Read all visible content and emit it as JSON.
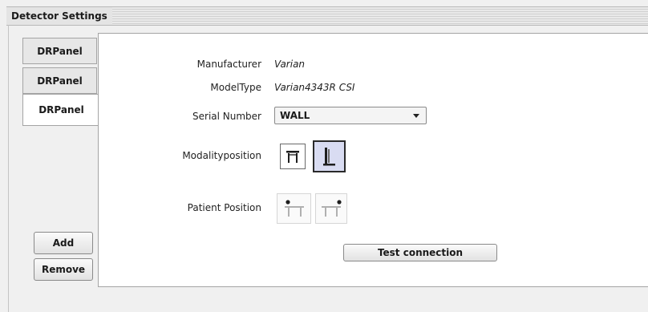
{
  "panel": {
    "title": "Detector Settings"
  },
  "tabs": [
    {
      "label": "DRPanel",
      "active": false
    },
    {
      "label": "DRPanel",
      "active": false
    },
    {
      "label": "DRPanel",
      "active": true
    }
  ],
  "sidebar_buttons": {
    "add": "Add",
    "remove": "Remove"
  },
  "form": {
    "manufacturer": {
      "label": "Manufacturer",
      "value": "Varian"
    },
    "model_type": {
      "label": "ModelType",
      "value": "Varian4343R CSI"
    },
    "serial_number": {
      "label": "Serial Number",
      "selected": "WALL"
    },
    "modality_position": {
      "label": "Modalityposition",
      "options": [
        {
          "icon": "table-detector-icon",
          "selected": false
        },
        {
          "icon": "wall-detector-icon",
          "selected": true
        }
      ]
    },
    "patient_position": {
      "label": "Patient Position",
      "options": [
        {
          "icon": "patient-head-left-icon",
          "enabled": false
        },
        {
          "icon": "patient-head-right-icon",
          "enabled": false
        }
      ]
    },
    "test_connection": "Test connection"
  },
  "colors": {
    "selected_bg": "#d9dcf2",
    "content_bg": "#ffffff",
    "panel_bg": "#f0f0f0"
  }
}
